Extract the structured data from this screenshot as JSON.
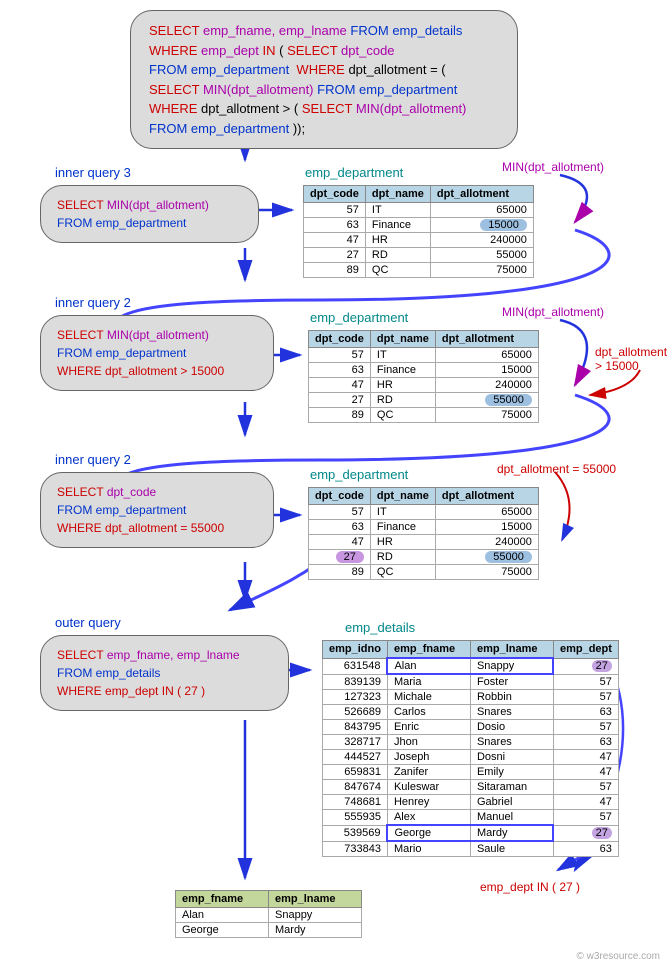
{
  "main_query": {
    "line1_select": "SELECT",
    "line1_cols": "emp_fname, emp_lname",
    "line1_from": "FROM",
    "line1_tbl": "emp_details",
    "line2_where": "WHERE",
    "line2_col": "emp_dept",
    "line2_in": "IN",
    "line2_open": "(",
    "line2_select": "SELECT",
    "line2_sub": "dpt_code",
    "line3_from": "FROM",
    "line3_tbl": "emp_department",
    "line3_where": "WHERE",
    "line3_cond": "dpt_allotment = (",
    "line4_select": "SELECT",
    "line4_fn": "MIN(dpt_allotment)",
    "line4_from": "FROM",
    "line4_tbl": "emp_department",
    "line5_where": "WHERE",
    "line5_cond": "dpt_allotment >",
    "line5_open": "(",
    "line5_select": "SELECT",
    "line5_fn": "MIN(dpt_allotment)",
    "line6_from": "FROM",
    "line6_tbl": "emp_department",
    "line6_close": "));"
  },
  "iq3": {
    "label": "inner query 3",
    "select": "SELECT",
    "fn": "MIN(dpt_allotment)",
    "from": "FROM",
    "tbl": "emp_department",
    "table_label": "emp_department",
    "annotation": "MIN(dpt_allotment)"
  },
  "iq2a": {
    "label": "inner query 2",
    "select": "SELECT",
    "fn": "MIN(dpt_allotment)",
    "from": "FROM",
    "tbl": "emp_department",
    "where": "WHERE",
    "cond_col": "dpt_allotment",
    "cond_rest": "> 15000",
    "table_label": "emp_department",
    "annotation": "MIN(dpt_allotment)",
    "annotation_red": "dpt_allotment\n> 15000"
  },
  "iq2b": {
    "label": "inner query 2",
    "select": "SELECT",
    "col": "dpt_code",
    "from": "FROM",
    "tbl": "emp_department",
    "where": "WHERE",
    "cond_col": "dpt_allotment",
    "cond_rest": "= 55000",
    "table_label": "emp_department",
    "annotation_red": "dpt_allotment = 55000"
  },
  "outer": {
    "label": "outer query",
    "select": "SELECT",
    "cols": "emp_fname, emp_lname",
    "from": "FROM",
    "tbl": "emp_details",
    "where": "WHERE",
    "cond_col": "emp_dept",
    "cond_in": "IN",
    "cond_rest": "( 27 )",
    "table_label": "emp_details",
    "annotation_red": "emp_dept IN ( 27 )"
  },
  "dept_table": {
    "headers": [
      "dpt_code",
      "dpt_name",
      "dpt_allotment"
    ],
    "rows": [
      [
        "57",
        "IT",
        "65000"
      ],
      [
        "63",
        "Finance",
        "15000"
      ],
      [
        "47",
        "HR",
        "240000"
      ],
      [
        "27",
        "RD",
        "55000"
      ],
      [
        "89",
        "QC",
        "75000"
      ]
    ]
  },
  "emp_table": {
    "headers": [
      "emp_idno",
      "emp_fname",
      "emp_lname",
      "emp_dept"
    ],
    "rows": [
      [
        "631548",
        "Alan",
        "Snappy",
        "27"
      ],
      [
        "839139",
        "Maria",
        "Foster",
        "57"
      ],
      [
        "127323",
        "Michale",
        "Robbin",
        "57"
      ],
      [
        "526689",
        "Carlos",
        "Snares",
        "63"
      ],
      [
        "843795",
        "Enric",
        "Dosio",
        "57"
      ],
      [
        "328717",
        "Jhon",
        "Snares",
        "63"
      ],
      [
        "444527",
        "Joseph",
        "Dosni",
        "47"
      ],
      [
        "659831",
        "Zanifer",
        "Emily",
        "47"
      ],
      [
        "847674",
        "Kuleswar",
        "Sitaraman",
        "57"
      ],
      [
        "748681",
        "Henrey",
        "Gabriel",
        "47"
      ],
      [
        "555935",
        "Alex",
        "Manuel",
        "57"
      ],
      [
        "539569",
        "George",
        "Mardy",
        "27"
      ],
      [
        "733843",
        "Mario",
        "Saule",
        "63"
      ]
    ]
  },
  "result": {
    "headers": [
      "emp_fname",
      "emp_lname"
    ],
    "rows": [
      [
        "Alan",
        "Snappy"
      ],
      [
        "George",
        "Mardy"
      ]
    ]
  },
  "attribution": "© w3resource.com"
}
